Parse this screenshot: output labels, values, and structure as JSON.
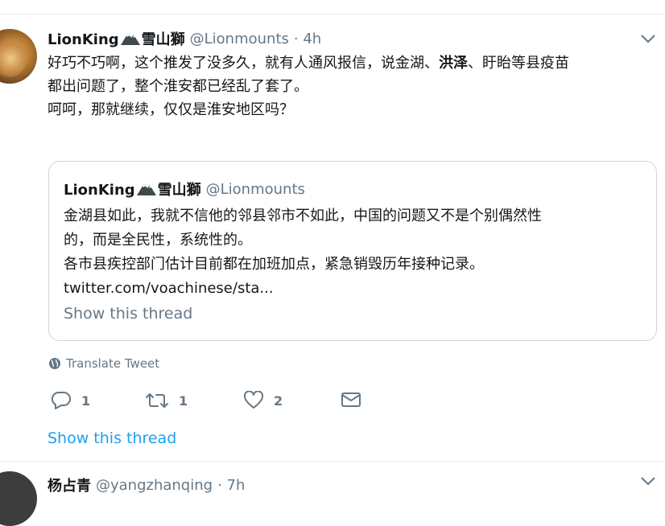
{
  "tweet": {
    "author_name": "LionKing",
    "author_name_suffix": "雪山獅",
    "handle": "@Lionmounts",
    "time": "· 4h",
    "text_line1_a": "好巧不巧啊，这个推发了没多久，就有人通风报信，说金湖、",
    "text_line1_bold": "洪泽",
    "text_line1_b": "、盱眙等县疫苗",
    "text_line2": "都出问题了，整个淮安都已经乱了套了。",
    "text_line3": "呵呵，那就继续，仅仅是淮安地区吗？",
    "icons": {
      "avatar": "lion-avatar",
      "menu": "chevron-down-icon",
      "name_emoji": "mountain-icon"
    }
  },
  "quote": {
    "author_name": "LionKing",
    "author_name_suffix": "雪山獅",
    "handle": "@Lionmounts",
    "text_line1": "金湖县如此，我就不信他的邻县邻市不如此，中国的问题又不是个别偶然性",
    "text_line2": "的，而是全民性，系统性的。",
    "text_line3": "各市县疾控部门估计目前都在加班加点，紧急销毁历年接种记录。",
    "link": "twitter.com/voachinese/sta...",
    "show_thread": "Show this thread"
  },
  "translate": {
    "label": "Translate Tweet",
    "icon": "globe-icon"
  },
  "actions": {
    "reply_count": "1",
    "retweet_count": "1",
    "like_count": "2",
    "icons": [
      "reply-icon",
      "retweet-icon",
      "like-icon",
      "direct-message-icon"
    ]
  },
  "show_thread": "Show this thread",
  "next_tweet": {
    "author_name": "杨占青",
    "handle": "@yangzhanqing",
    "time": "· 7h"
  },
  "colors": {
    "link": "#1da1f2",
    "muted": "#657786",
    "text": "#14171a",
    "border": "#ccd6dd"
  }
}
